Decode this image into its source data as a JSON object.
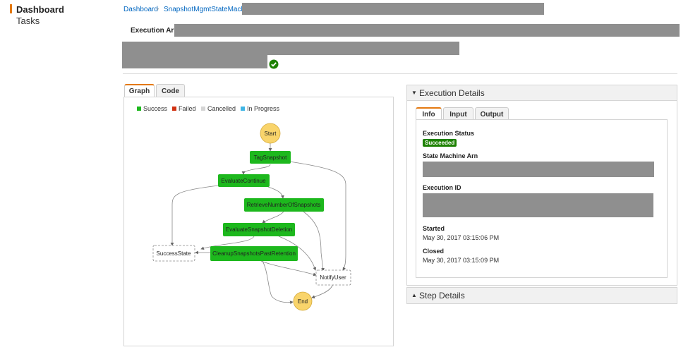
{
  "nav": {
    "items": [
      {
        "label": "Dashboard",
        "active": true
      },
      {
        "label": "Tasks",
        "active": false
      }
    ],
    "accent_color": "#e47911"
  },
  "breadcrumb": {
    "root": "Dashboard",
    "separator": "›",
    "current": "SnapshotMgmtStateMachine"
  },
  "execution": {
    "arn_label": "Execution Arn:",
    "status_icon": "check-circle-icon"
  },
  "graph_panel": {
    "tabs": [
      "Graph",
      "Code"
    ],
    "active_tab": "Graph",
    "legend": [
      {
        "label": "Success",
        "color": "#1db81d"
      },
      {
        "label": "Failed",
        "color": "#d13212"
      },
      {
        "label": "Cancelled",
        "color": "#d5d5d5"
      },
      {
        "label": "In Progress",
        "color": "#3fb5e5"
      }
    ],
    "nodes": {
      "start": "Start",
      "tag": "TagSnapshot",
      "evalcont": "EvaluateContinue",
      "retrieve": "RetrieveNumberOfSnapshots",
      "evaldel": "EvaluateSnapshotDeletion",
      "success": "SuccessState",
      "cleanup": "CleanupSnapshotsPastRetention",
      "notify": "NotifyUser",
      "end": "End"
    }
  },
  "execution_details": {
    "title": "Execution Details",
    "tabs": [
      "Info",
      "Input",
      "Output"
    ],
    "active_tab": "Info",
    "status_label": "Execution Status",
    "status_value": "Succeeded",
    "state_machine_arn_label": "State Machine Arn",
    "execution_id_label": "Execution ID",
    "started_label": "Started",
    "started_value": "May 30, 2017 03:15:06 PM",
    "closed_label": "Closed",
    "closed_value": "May 30, 2017 03:15:09 PM"
  },
  "step_details": {
    "title": "Step Details"
  }
}
